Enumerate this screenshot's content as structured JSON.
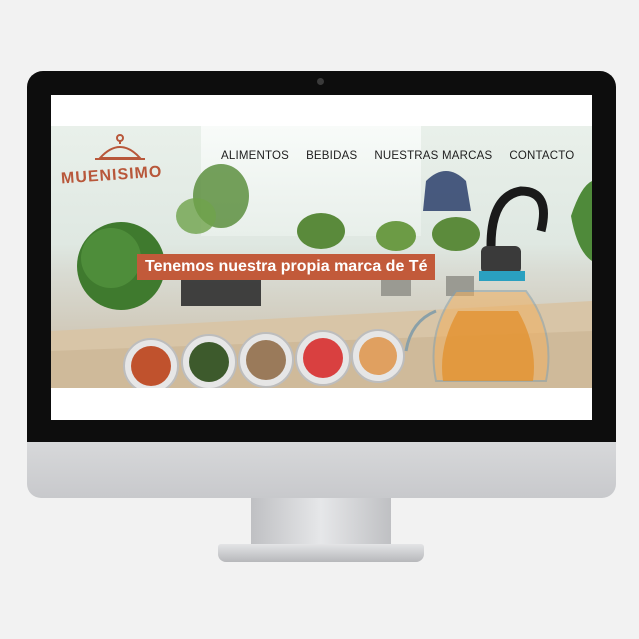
{
  "site": {
    "logo_text": "MUENISIMO",
    "nav": [
      "ALIMENTOS",
      "BEBIDAS",
      "NUESTRAS MARCAS",
      "CONTACTO"
    ],
    "hero_banner": "Tenemos nuestra propia marca de Té"
  },
  "colors": {
    "brand": "#c25a3a",
    "monitor_bezel": "#0d0d0d",
    "monitor_chin": "#cbccce",
    "nav_text": "#1d1d1d"
  }
}
